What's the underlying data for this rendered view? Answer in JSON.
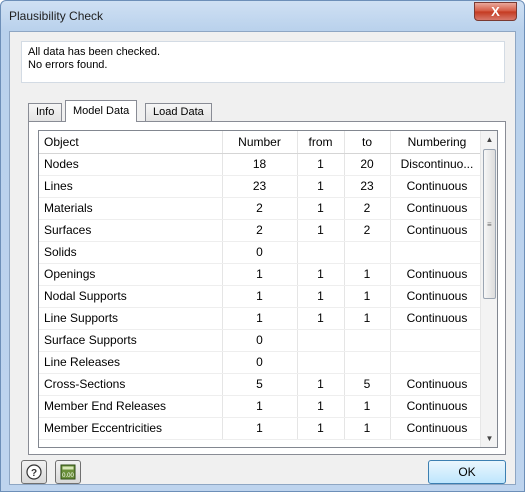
{
  "window": {
    "title": "Plausibility Check",
    "close_label": "X"
  },
  "message": {
    "line1": "All data has been checked.",
    "line2": "No errors found."
  },
  "tabs": [
    {
      "label": "Info",
      "active": false
    },
    {
      "label": "Model Data",
      "active": true
    },
    {
      "label": "Load Data",
      "active": false
    }
  ],
  "table": {
    "headers": [
      "Object",
      "Number",
      "from",
      "to",
      "Numbering"
    ],
    "rows": [
      [
        "Nodes",
        "18",
        "1",
        "20",
        "Discontinuo..."
      ],
      [
        "Lines",
        "23",
        "1",
        "23",
        "Continuous"
      ],
      [
        "Materials",
        "2",
        "1",
        "2",
        "Continuous"
      ],
      [
        "Surfaces",
        "2",
        "1",
        "2",
        "Continuous"
      ],
      [
        "Solids",
        "0",
        "",
        "",
        ""
      ],
      [
        "Openings",
        "1",
        "1",
        "1",
        "Continuous"
      ],
      [
        "Nodal Supports",
        "1",
        "1",
        "1",
        "Continuous"
      ],
      [
        "Line Supports",
        "1",
        "1",
        "1",
        "Continuous"
      ],
      [
        "Surface Supports",
        "0",
        "",
        "",
        ""
      ],
      [
        "Line Releases",
        "0",
        "",
        "",
        ""
      ],
      [
        "Cross-Sections",
        "5",
        "1",
        "5",
        "Continuous"
      ],
      [
        "Member End Releases",
        "1",
        "1",
        "1",
        "Continuous"
      ],
      [
        "Member Eccentricities",
        "1",
        "1",
        "1",
        "Continuous"
      ]
    ]
  },
  "icons": {
    "help": "help-icon",
    "units": "units-icon"
  },
  "units_icon_text": "0.00",
  "ok_label": "OK"
}
